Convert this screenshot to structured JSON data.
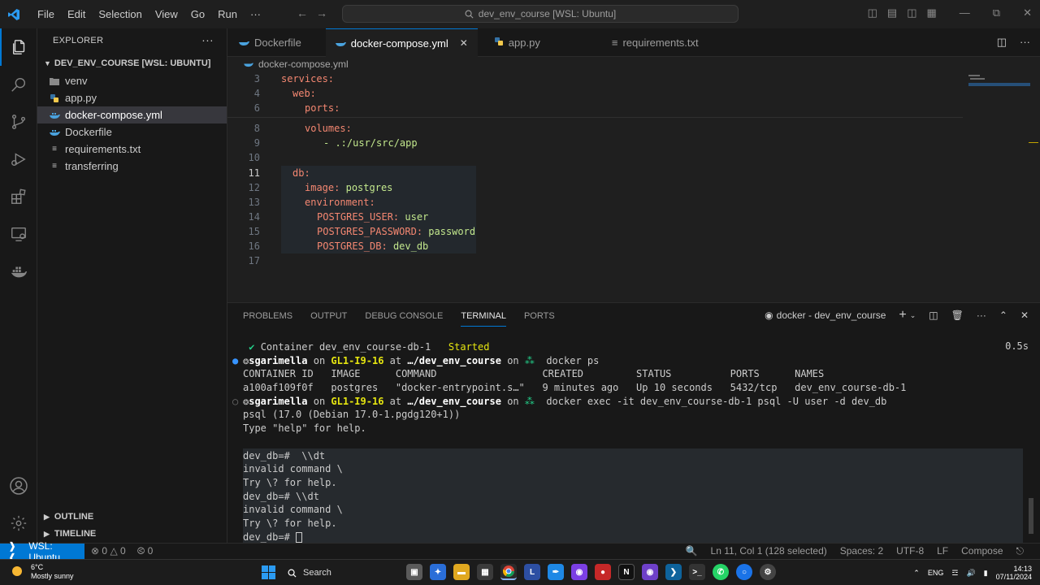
{
  "titlebar": {
    "menu": [
      "File",
      "Edit",
      "Selection",
      "View",
      "Go",
      "Run",
      "···"
    ],
    "search": "dev_env_course [WSL: Ubuntu]"
  },
  "sidebar": {
    "title": "EXPLORER",
    "root": "DEV_ENV_COURSE [WSL: UBUNTU]",
    "items": [
      {
        "label": "venv",
        "kind": "folder"
      },
      {
        "label": "app.py",
        "kind": "python"
      },
      {
        "label": "docker-compose.yml",
        "kind": "docker"
      },
      {
        "label": "Dockerfile",
        "kind": "docker"
      },
      {
        "label": "requirements.txt",
        "kind": "text"
      },
      {
        "label": "transferring",
        "kind": "text"
      }
    ],
    "outline": "OUTLINE",
    "timeline": "TIMELINE"
  },
  "tabs": [
    {
      "label": "Dockerfile",
      "active": false
    },
    {
      "label": "docker-compose.yml",
      "active": true
    },
    {
      "label": "app.py",
      "active": false
    },
    {
      "label": "requirements.txt",
      "active": false
    }
  ],
  "breadcrumb": "docker-compose.yml",
  "editor": {
    "line_numbers": [
      "3",
      "4",
      "6",
      "8",
      "9",
      "10",
      "11",
      "12",
      "13",
      "14",
      "15",
      "16",
      "17"
    ],
    "lines": {
      "services": "services:",
      "web": "web:",
      "ports": "ports:",
      "volumes": "volumes:",
      "volume_item": "- .:/usr/src/app",
      "db": "db:",
      "image_key": "image:",
      "image_val": "postgres",
      "env": "environment:",
      "user_key": "POSTGRES_USER:",
      "user_val": "user",
      "pass_key": "POSTGRES_PASSWORD:",
      "pass_val": "password",
      "dbname_key": "POSTGRES_DB:",
      "dbname_val": "dev_db"
    }
  },
  "panel": {
    "tabs": [
      "PROBLEMS",
      "OUTPUT",
      "DEBUG CONSOLE",
      "TERMINAL",
      "PORTS"
    ],
    "terminal_name": "docker - dev_env_course",
    "elapsed": "0.5s",
    "terminal": {
      "l1_check": "✔",
      "l1_text": "Container dev_env_course-db-1",
      "l1_status": "Started",
      "prompt_user": "sgarimella",
      "on": "on",
      "host": "GL1-I9-16",
      "at": "at",
      "path": "…/dev_env_course",
      "cmd1": "docker ps",
      "header": "CONTAINER ID   IMAGE      COMMAND                  CREATED         STATUS          PORTS      NAMES",
      "row": "a100af109f0f   postgres   \"docker-entrypoint.s…\"   9 minutes ago   Up 10 seconds   5432/tcp   dev_env_course-db-1",
      "cmd2": "docker exec -it dev_env_course-db-1 psql -U user -d dev_db",
      "psql_ver": "psql (17.0 (Debian 17.0-1.pgdg120+1))",
      "help_hint": "Type \"help\" for help.",
      "p1": "dev_db=#  \\\\dt",
      "e1": "invalid command \\",
      "t1": "Try \\? for help.",
      "p2": "dev_db=# \\\\dt",
      "e2": "invalid command \\",
      "t2": "Try \\? for help.",
      "p3": "dev_db=# "
    }
  },
  "statusbar": {
    "remote": "WSL: Ubuntu",
    "errors": "0",
    "warnings": "0",
    "ports": "0",
    "position": "Ln 11, Col 1 (128 selected)",
    "spaces": "Spaces: 2",
    "encoding": "UTF-8",
    "eol": "LF",
    "language": "Compose"
  },
  "taskbar": {
    "temp": "6°C",
    "weather": "Mostly sunny",
    "search": "Search",
    "lang": "ENG",
    "time": "14:13",
    "date": "07/11/2024"
  },
  "colors": {
    "accent": "#0078d4",
    "editor_bg": "#1f1f1f",
    "sidebar_bg": "#181818"
  }
}
